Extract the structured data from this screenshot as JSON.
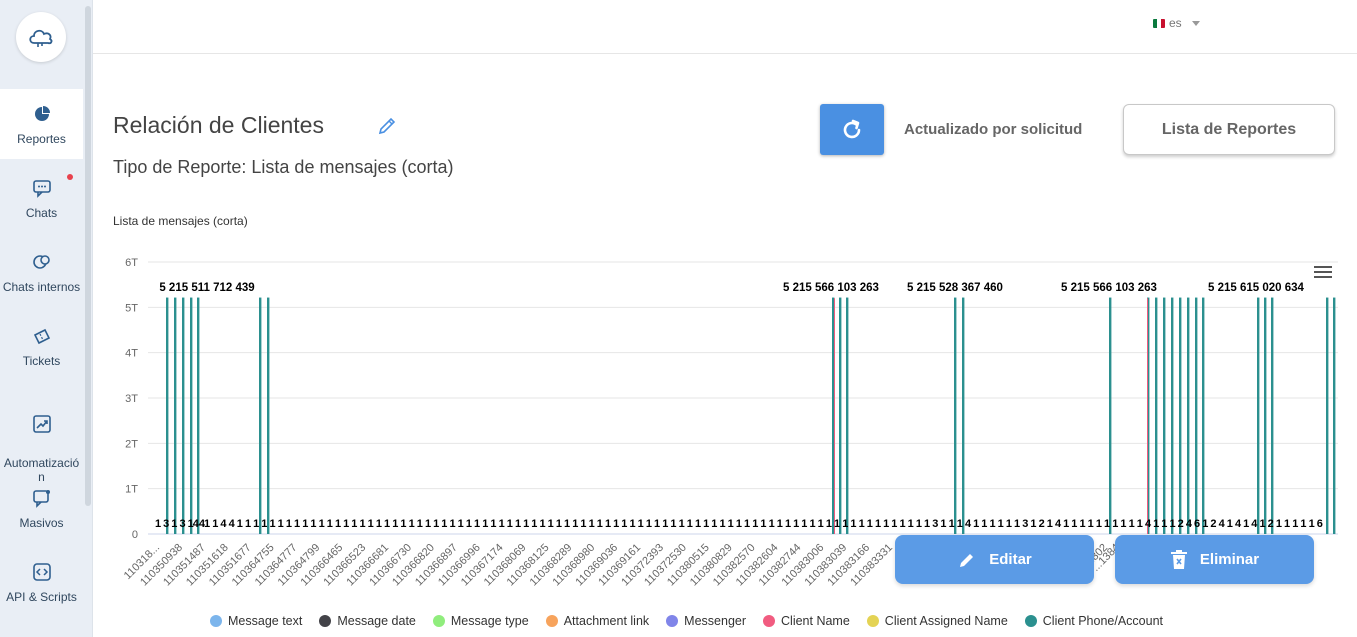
{
  "language": "es",
  "sidebar": {
    "items": [
      {
        "label": "Reportes",
        "icon": "pie-chart-icon"
      },
      {
        "label": "Chats",
        "icon": "chat-bubble-icon"
      },
      {
        "label": "Chats internos",
        "icon": "internal-chat-icon"
      },
      {
        "label": "Tickets",
        "icon": "ticket-icon"
      },
      {
        "label": "Automatizació\nn",
        "icon": "trend-icon"
      },
      {
        "label": "Masivos",
        "icon": "broadcast-icon"
      },
      {
        "label": "API & Scripts",
        "icon": "code-icon"
      }
    ]
  },
  "report": {
    "title": "Relación de Clientes",
    "subtitle": "Tipo de Reporte: Lista de mensajes (corta)",
    "updated_label": "Actualizado por solicitud",
    "list_button": "Lista de Reportes",
    "edit_button": "Editar",
    "delete_button": "Eliminar"
  },
  "colors": {
    "accent": "#4a90e2",
    "series_main": "#2a9d8f"
  },
  "chart_data": {
    "type": "bar",
    "title": "Lista de mensajes (corta)",
    "y_ticks": [
      "0",
      "1T",
      "2T",
      "3T",
      "4T",
      "5T",
      "6T"
    ],
    "ylim": [
      0,
      6000000000000
    ],
    "peak_labels": [
      "5 215 511 712 439",
      "5 215 566 103 263",
      "5 215 528 367 460",
      "5 215 566 103 263",
      "5 215 615 020 634"
    ],
    "x_labels": [
      "110318...",
      "110350938",
      "110351487",
      "110351618",
      "110351677",
      "110364755",
      "110364777",
      "110364799",
      "110366465",
      "110366523",
      "110366681",
      "110366730",
      "110366820",
      "110366897",
      "110366996",
      "110367174",
      "110368069",
      "110368125",
      "110368289",
      "110368980",
      "110369036",
      "110369161",
      "110372393",
      "110372530",
      "110380515",
      "110380829",
      "110382570",
      "110382604",
      "110382744",
      "110383006",
      "110383039",
      "110383166",
      "110383331"
    ],
    "x_labels_right": [
      "...802",
      "...1384"
    ],
    "bottom_labels": [
      "1",
      "3",
      "1",
      "3",
      "1",
      "44",
      "1",
      "1",
      "4",
      "4",
      "1",
      "1",
      "1",
      "1",
      "1",
      "1",
      "1",
      "1",
      "1",
      "1",
      "1",
      "1",
      "1",
      "1",
      "1",
      "1",
      "1",
      "1",
      "1",
      "1",
      "1",
      "1",
      "1",
      "1",
      "1",
      "1",
      "1",
      "1",
      "1",
      "1",
      "1",
      "1",
      "1",
      "1",
      "1",
      "1",
      "1",
      "1",
      "1",
      "1",
      "1",
      "1",
      "1",
      "1",
      "1",
      "1",
      "1",
      "1",
      "1",
      "1",
      "1",
      "1",
      "1",
      "1",
      "1",
      "1",
      "1",
      "1",
      "1",
      "1",
      "1",
      "1",
      "1",
      "1",
      "1",
      "1",
      "1",
      "1",
      "1",
      "1",
      "1",
      "1",
      "1",
      "1",
      "1",
      "1",
      "1",
      "1",
      "1",
      "1",
      "1",
      "1",
      "1",
      "1",
      "1",
      "3",
      "1",
      "1",
      "1",
      "4",
      "1",
      "1",
      "1",
      "1",
      "1",
      "1",
      "3",
      "1",
      "2",
      "1",
      "4",
      "1",
      "1",
      "1",
      "1",
      "1",
      "1",
      "1",
      "1",
      "1",
      "1",
      "4",
      "1",
      "1",
      "1",
      "2",
      "4",
      "6",
      "1",
      "2",
      "4",
      "1",
      "4",
      "1",
      "4",
      "1",
      "2",
      "1",
      "1",
      "1",
      "1",
      "1",
      "6"
    ],
    "tall_bars": [
      {
        "category_index": 0,
        "value": 5215511712439
      },
      {
        "category_index": 1,
        "value": 5215511712439
      },
      {
        "category_index": 2,
        "value": 5215511712439
      },
      {
        "category_index": 3,
        "value": 5215511712439
      },
      {
        "category_index": 4,
        "value": 5215511712439
      },
      {
        "category_index": 5,
        "value": 5215511712439
      },
      {
        "category_index": 6,
        "value": 5215511712439
      },
      {
        "category_index": 7,
        "value": 5215511712439
      },
      {
        "category_index": 8,
        "value": 5215566103263
      },
      {
        "category_index": 9,
        "value": 5215566103263
      },
      {
        "category_index": 10,
        "value": 5215566103263
      },
      {
        "category_index": 11,
        "value": 5215528367460
      },
      {
        "category_index": 12,
        "value": 5215528367460
      },
      {
        "category_index": 13,
        "value": 5215566103263
      },
      {
        "category_index": 14,
        "value": 5215566103263
      },
      {
        "category_index": 15,
        "value": 5215566103263
      },
      {
        "category_index": 16,
        "value": 5215566103263
      },
      {
        "category_index": 17,
        "value": 5215566103263
      },
      {
        "category_index": 18,
        "value": 5215566103263
      },
      {
        "category_index": 19,
        "value": 5215566103263
      },
      {
        "category_index": 20,
        "value": 5215566103263
      },
      {
        "category_index": 21,
        "value": 5215615020634
      },
      {
        "category_index": 22,
        "value": 5215615020634
      },
      {
        "category_index": 23,
        "value": 5215615020634
      },
      {
        "category_index": 24,
        "value": 5215615020634
      },
      {
        "category_index": 25,
        "value": 5215615020634
      }
    ],
    "legend": [
      {
        "name": "Message text",
        "color": "#7cb5ec"
      },
      {
        "name": "Message date",
        "color": "#434348"
      },
      {
        "name": "Message type",
        "color": "#90ed7d"
      },
      {
        "name": "Attachment link",
        "color": "#f7a35c"
      },
      {
        "name": "Messenger",
        "color": "#8085e9"
      },
      {
        "name": "Client Name",
        "color": "#f15c80"
      },
      {
        "name": "Client Assigned Name",
        "color": "#e4d354"
      },
      {
        "name": "Client Phone/Account",
        "color": "#2b908f"
      }
    ],
    "grid": true,
    "legend_position": "bottom"
  }
}
